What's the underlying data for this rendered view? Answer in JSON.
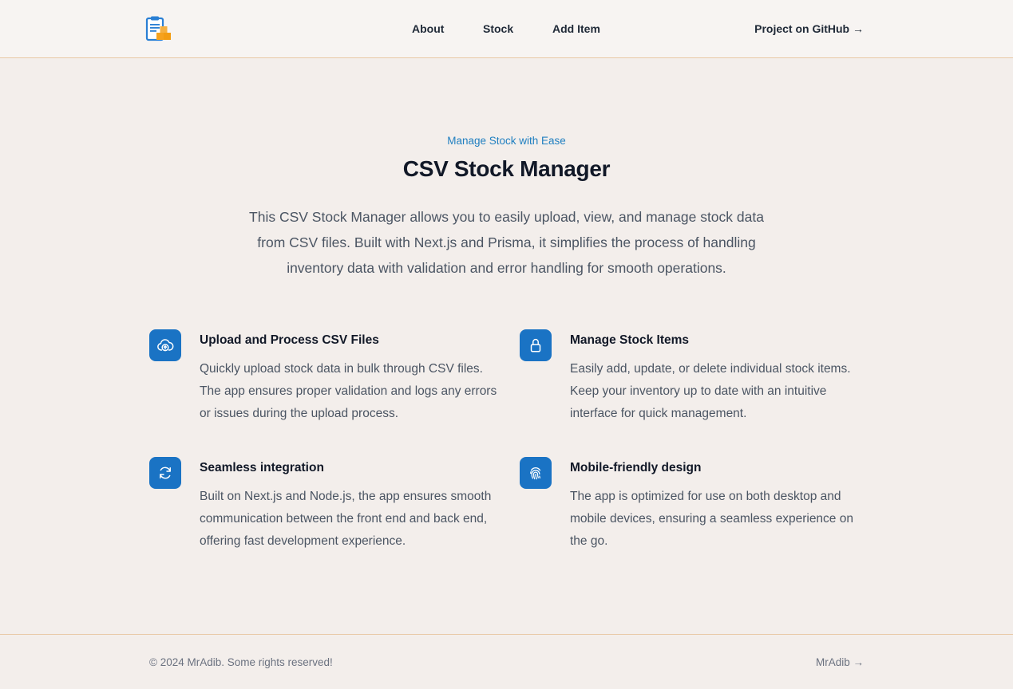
{
  "header": {
    "logo_icon": "clipboard-boxes-icon",
    "nav": [
      {
        "label": "About"
      },
      {
        "label": "Stock"
      },
      {
        "label": "Add Item"
      }
    ],
    "github_link": "Project on GitHub →"
  },
  "hero": {
    "eyebrow": "Manage Stock with Ease",
    "title": "CSV Stock Manager",
    "description": "This CSV Stock Manager allows you to easily upload, view, and manage stock data from CSV files. Built with Next.js and Prisma, it simplifies the process of handling inventory data with validation and error handling for smooth operations."
  },
  "features": [
    {
      "icon": "cloud-upload-icon",
      "title": "Upload and Process CSV Files",
      "description": "Quickly upload stock data in bulk through CSV files. The app ensures proper validation and logs any errors or issues during the upload process."
    },
    {
      "icon": "lock-icon",
      "title": "Manage Stock Items",
      "description": "Easily add, update, or delete individual stock items. Keep your inventory up to date with an intuitive interface for quick management."
    },
    {
      "icon": "refresh-icon",
      "title": "Seamless integration",
      "description": "Built on Next.js and Node.js, the app ensures smooth communication between the front end and back end, offering fast development experience."
    },
    {
      "icon": "fingerprint-icon",
      "title": "Mobile-friendly design",
      "description": "The app is optimized for use on both desktop and mobile devices, ensuring a seamless experience on the go."
    }
  ],
  "footer": {
    "copyright": "© 2024 MrAdib. Some rights reserved!",
    "author_link": "MrAdib →"
  },
  "colors": {
    "accent": "#1a73c4",
    "eyebrow": "#1f7fc0",
    "background": "#f3eeeb",
    "divider": "#e8c9a6"
  }
}
